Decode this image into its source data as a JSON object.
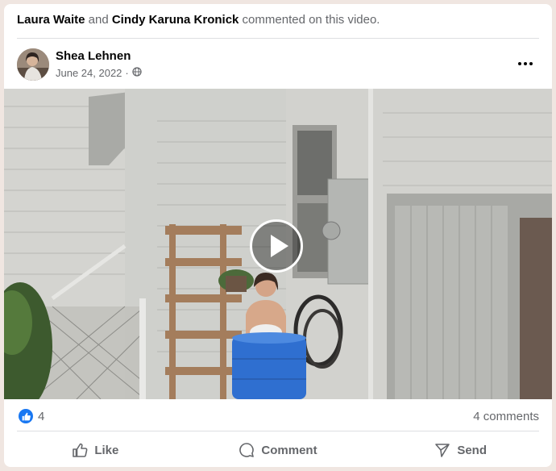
{
  "context": {
    "user1": "Laura Waite",
    "conjunction": "and",
    "user2": "Cindy Karuna Kronick",
    "suffix": "commented on this video."
  },
  "post": {
    "author": "Shea Lehnen",
    "date": "June 24, 2022",
    "separator": "·",
    "audience_icon": "globe-icon",
    "more_icon": "more-dots-icon"
  },
  "video": {
    "play_icon": "play-icon"
  },
  "stats": {
    "reactions": "4",
    "comments": "4 comments"
  },
  "actions": {
    "like": "Like",
    "comment": "Comment",
    "send": "Send"
  },
  "colors": {
    "accent": "#1877f2",
    "secondary_text": "#65676b",
    "background": "#f0e6e1"
  }
}
